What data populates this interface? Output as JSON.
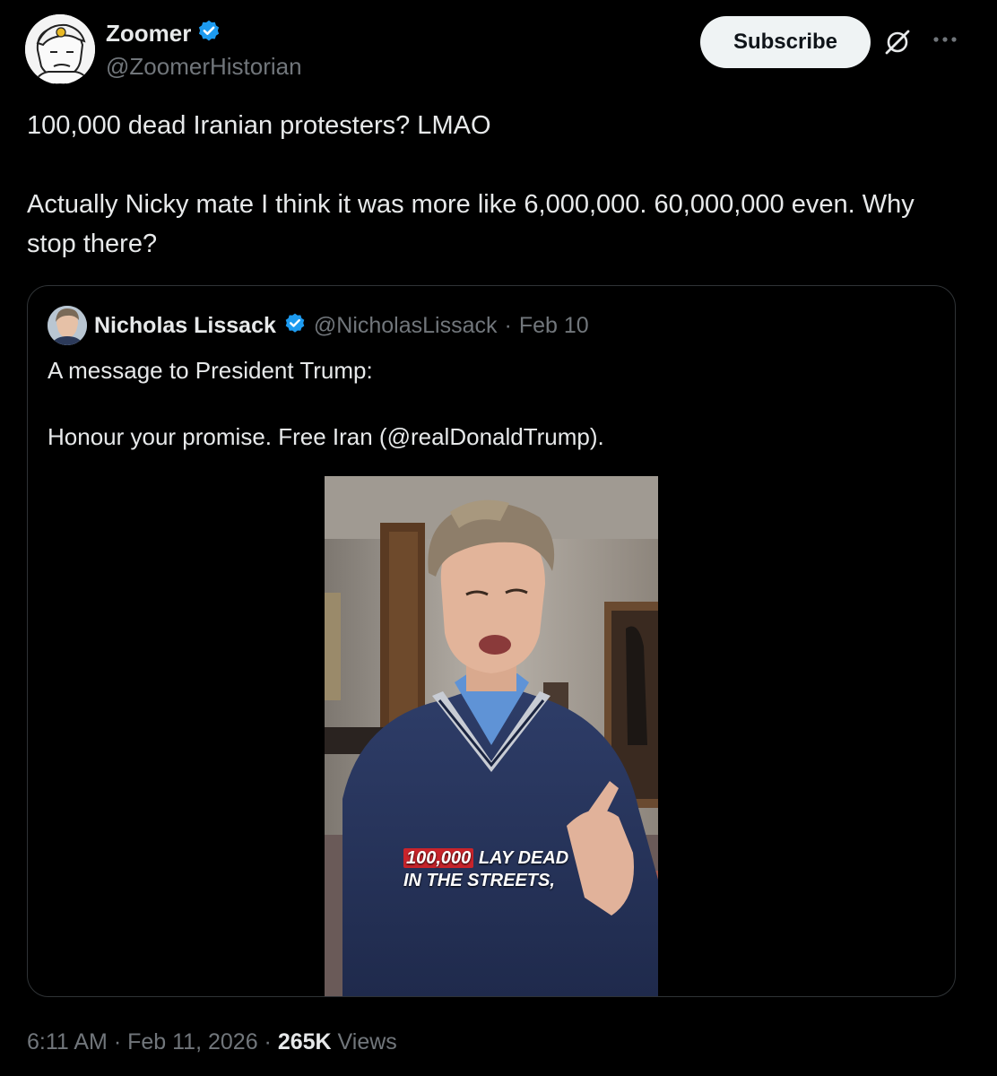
{
  "author": {
    "display_name": "Zoomer",
    "handle": "@ZoomerHistorian",
    "verified": true
  },
  "actions": {
    "subscribe_label": "Subscribe",
    "grok_icon": "grok-icon",
    "more_icon": "more-icon"
  },
  "tweet": {
    "text_line1": "100,000 dead Iranian protesters? LMAO",
    "text_line2": "Actually Nicky mate I think it was more like 6,000,000. 60,000,000 even. Why stop there?"
  },
  "quote": {
    "display_name": "Nicholas Lissack",
    "handle": "@NicholasLissack",
    "separator": "·",
    "date": "Feb 10",
    "verified": true,
    "text_line1": "A message to President Trump:",
    "text_line2": "Honour your promise. Free Iran (@realDonaldTrump).",
    "video_caption": {
      "highlight": "100,000",
      "line1_rest": "LAY DEAD",
      "line2": "IN THE STREETS,"
    }
  },
  "footer": {
    "time": "6:11 AM",
    "sep1": "·",
    "date": "Feb 11, 2026",
    "sep2": "·",
    "views_count": "265K",
    "views_label": "Views"
  },
  "colors": {
    "background": "#000000",
    "text_primary": "#e7e9ea",
    "text_secondary": "#71767b",
    "verified_blue": "#1d9bf0",
    "border": "#2f3336",
    "caption_highlight": "#c8242b"
  }
}
